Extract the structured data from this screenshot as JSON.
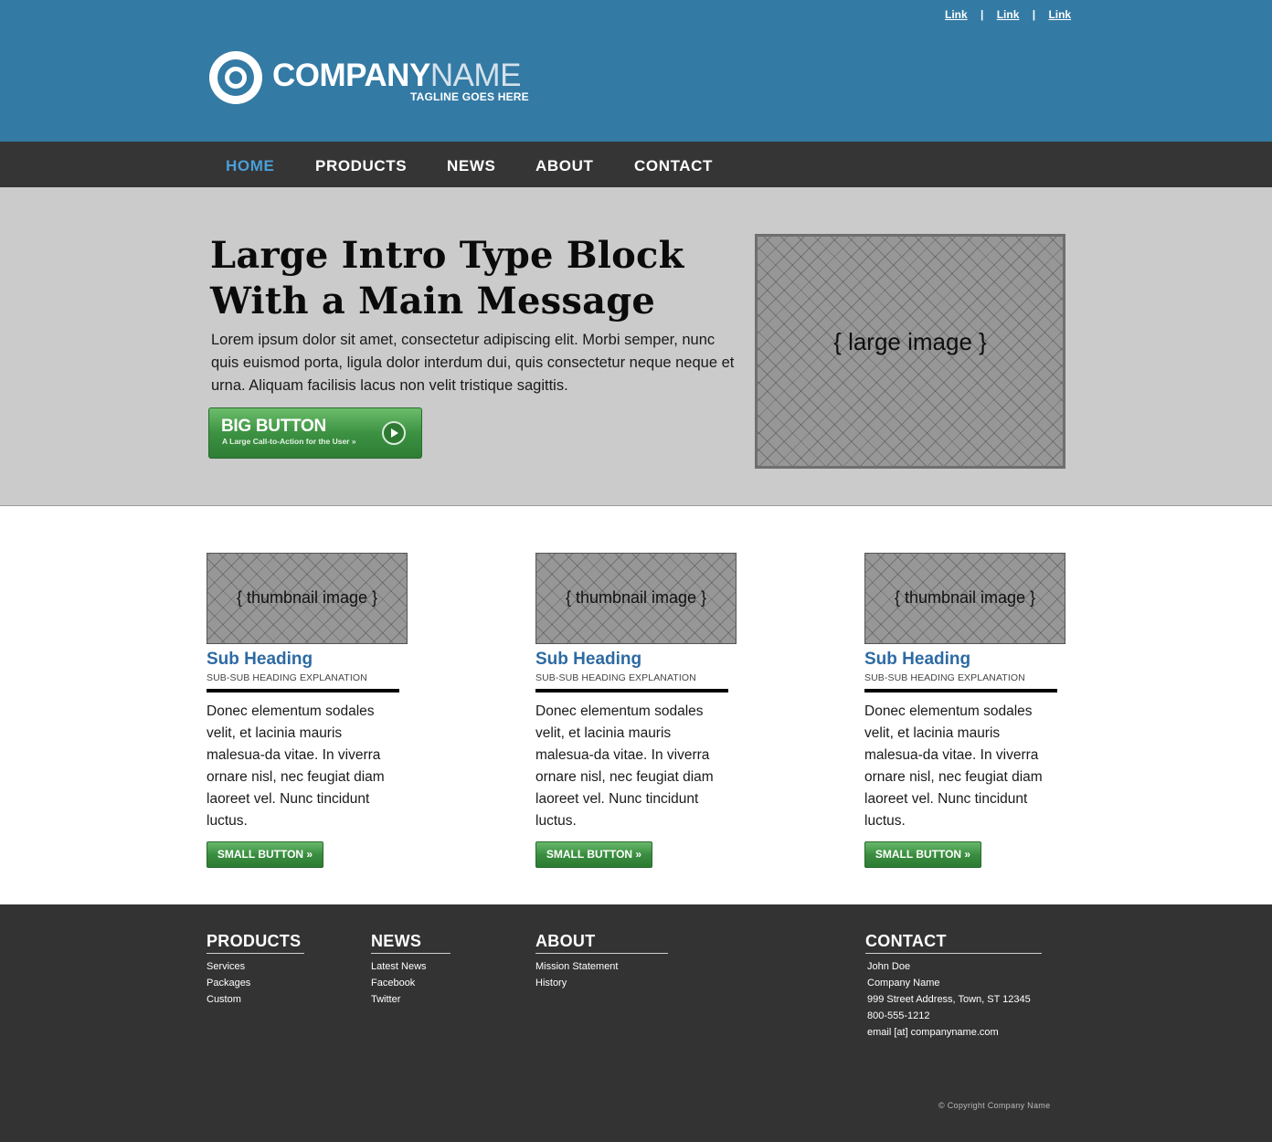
{
  "header": {
    "top_links": [
      "Link",
      "Link",
      "Link"
    ],
    "top_link_separator": "|",
    "logo": {
      "name_bold": "COMPANY",
      "name_light": "NAME",
      "tagline": "TAGLINE GOES HERE"
    }
  },
  "nav": {
    "items": [
      {
        "label": "HOME",
        "active": true
      },
      {
        "label": "PRODUCTS",
        "active": false
      },
      {
        "label": "NEWS",
        "active": false
      },
      {
        "label": "ABOUT",
        "active": false
      },
      {
        "label": "CONTACT",
        "active": false
      }
    ]
  },
  "hero": {
    "title_line1": "Large Intro Type Block",
    "title_line2": "With a Main Message",
    "text": "Lorem ipsum dolor sit amet, consectetur adipiscing elit. Morbi semper, nunc quis euismod porta, ligula dolor interdum dui, quis consectetur neque neque et urna.  Aliquam facilisis lacus non velit tristique sagittis.",
    "button_label": "BIG BUTTON",
    "button_sublabel": "A Large Call-to-Action for the User »",
    "image_label": "{ large image }"
  },
  "columns": [
    {
      "image_label": "{ thumbnail image }",
      "heading": "Sub Heading",
      "subheading": "SUB-SUB HEADING EXPLANATION",
      "text": "Donec elementum sodales velit, et lacinia mauris malesua-da vitae. In viverra ornare nisl, nec feugiat diam laoreet vel. Nunc tincidunt luctus.",
      "button_label": "SMALL BUTTON »"
    },
    {
      "image_label": "{ thumbnail image }",
      "heading": "Sub Heading",
      "subheading": "SUB-SUB HEADING EXPLANATION",
      "text": "Donec elementum sodales velit, et lacinia mauris malesua-da vitae. In viverra ornare nisl, nec feugiat diam laoreet vel. Nunc tincidunt luctus.",
      "button_label": "SMALL BUTTON »"
    },
    {
      "image_label": "{ thumbnail image }",
      "heading": "Sub Heading",
      "subheading": "SUB-SUB HEADING EXPLANATION",
      "text": "Donec elementum sodales velit, et lacinia mauris malesua-da vitae. In viverra ornare nisl, nec feugiat diam laoreet vel. Nunc tincidunt luctus.",
      "button_label": "SMALL BUTTON »"
    }
  ],
  "footer": {
    "products": {
      "heading": "PRODUCTS",
      "items": [
        "Services",
        "Packages",
        "Custom"
      ]
    },
    "news": {
      "heading": "NEWS",
      "items": [
        "Latest News",
        "Facebook",
        "Twitter"
      ]
    },
    "about": {
      "heading": "ABOUT",
      "items": [
        "Mission Statement",
        "History"
      ]
    },
    "contact": {
      "heading": "CONTACT",
      "lines": [
        "John Doe",
        "Company Name",
        "999 Street Address, Town, ST 12345",
        "800-555-1212",
        "email [at] companyname.com"
      ]
    },
    "copyright": "© Copyright Company Name"
  },
  "colors": {
    "header_bg": "#337aa4",
    "nav_bg": "#353535",
    "nav_active": "#4a9fd8",
    "hero_bg": "#cbcbcb",
    "subheading": "#2d6aa3",
    "button_green": "#3a8e40",
    "footer_bg": "#333333"
  },
  "icons": [
    "target-logo-icon",
    "play-arrow-icon"
  ]
}
